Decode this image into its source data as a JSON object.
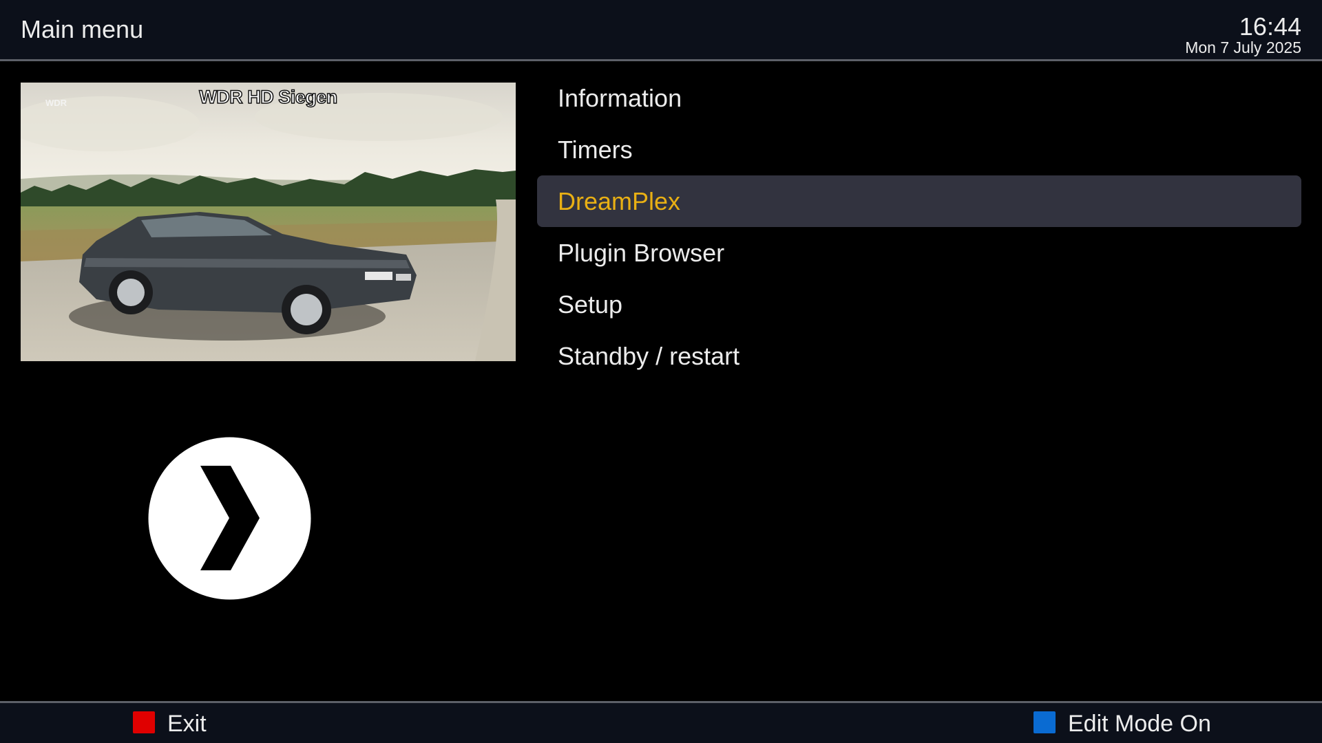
{
  "header": {
    "title": "Main menu",
    "time": "16:44",
    "date": "Mon 7 July 2025"
  },
  "preview": {
    "channel_name": "WDR HD Siegen",
    "channel_logo": "WDR"
  },
  "plugin_icon": {
    "name": "plex-chevron-icon"
  },
  "menu": {
    "items": [
      {
        "label": "Information",
        "selected": false
      },
      {
        "label": "Timers",
        "selected": false
      },
      {
        "label": "DreamPlex",
        "selected": true
      },
      {
        "label": "Plugin Browser",
        "selected": false
      },
      {
        "label": "Setup",
        "selected": false
      },
      {
        "label": "Standby / restart",
        "selected": false
      }
    ]
  },
  "footer": {
    "red_key": {
      "label": "Exit",
      "color": "#e00000"
    },
    "blue_key": {
      "label": "Edit Mode On",
      "color": "#0a6bd2"
    }
  },
  "colors": {
    "selected_text": "#e9b014",
    "selected_bg": "#32333f",
    "header_bg": "#0c101a"
  }
}
